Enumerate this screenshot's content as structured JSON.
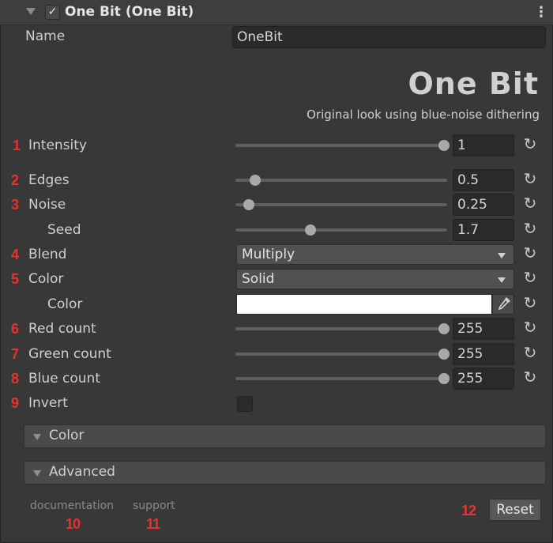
{
  "header": {
    "title": "One Bit (One Bit)",
    "enabled": true,
    "menu_glyph": "⋮"
  },
  "name_field": {
    "label": "Name",
    "value": "OneBit"
  },
  "logo": {
    "title": "One Bit",
    "subtitle": "Original look using blue-noise dithering"
  },
  "properties": [
    {
      "marker": "1",
      "label": "Intensity",
      "value": "1",
      "slider_fraction": 1.0
    },
    {
      "marker": "2",
      "label": "Edges",
      "value": "0.5",
      "slider_fraction": 0.08
    },
    {
      "marker": "3",
      "label": "Noise",
      "value": "0.25",
      "slider_fraction": 0.05
    },
    {
      "marker": "",
      "label": "Seed",
      "value": "1.7",
      "slider_fraction": 0.35
    },
    {
      "marker": "4",
      "label": "Blend",
      "value": "Multiply",
      "type": "dropdown"
    },
    {
      "marker": "5",
      "label": "Color",
      "value": "Solid",
      "type": "dropdown"
    },
    {
      "marker": "",
      "label": "Color",
      "type": "color",
      "color": "#ffffff"
    },
    {
      "marker": "6",
      "label": "Red count",
      "value": "255",
      "slider_fraction": 1.0
    },
    {
      "marker": "7",
      "label": "Green count",
      "value": "255",
      "slider_fraction": 1.0
    },
    {
      "marker": "8",
      "label": "Blue count",
      "value": "255",
      "slider_fraction": 1.0
    },
    {
      "marker": "9",
      "label": "Invert",
      "type": "checkbox",
      "checked": false
    }
  ],
  "sections": [
    {
      "label": "Color"
    },
    {
      "label": "Advanced"
    }
  ],
  "footer": {
    "documentation": "documentation",
    "support": "support",
    "marker_documentation": "10",
    "marker_support": "11",
    "marker_reset": "12",
    "reset_label": "Reset"
  },
  "icons": {
    "reset": "reset-icon",
    "eyedropper": "eyedropper-icon",
    "fold": "foldout-triangle-icon"
  },
  "colors": {
    "marker": "#e8322b",
    "background": "#383838"
  }
}
